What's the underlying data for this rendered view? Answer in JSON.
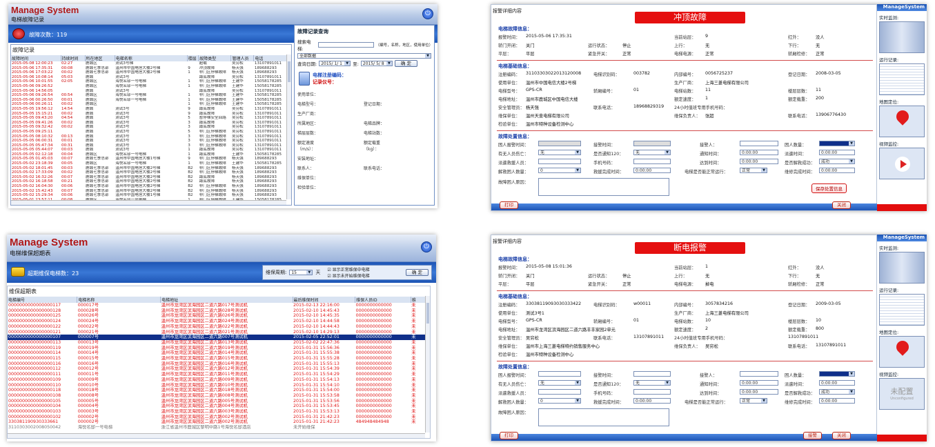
{
  "p1": {
    "brand": "Manage System",
    "subtitle": "电梯故障记录",
    "fault_count": "故障次数：119",
    "table_caption": "故障记录",
    "columns": [
      "故障时间",
      "持续时间",
      "所在地区",
      "电梯名称",
      "楼层",
      "故障类型",
      "管理人员",
      "电话"
    ],
    "rows": [
      [
        "2015-05-08 12:00:23",
        "02:27",
        "鹿城区",
        "测试3号梯",
        "",
        "超载",
        "吴穷松",
        "13107891011"
      ],
      [
        "2015-05-06 17:35:31",
        "00:08",
        "鹿城七季总部",
        "温州市中国电信大楼2号梯",
        "9",
        "冲顶故障",
        "杨天强",
        "189688293"
      ],
      [
        "2015-05-06 17:03:22",
        "00:02",
        "鹿城七季总部",
        "温州市中国电信大楼2号梯",
        "1",
        "非门区停梯故障",
        "杨天强",
        "189688293"
      ],
      [
        "2015-05-06 10:08:14",
        "05:03",
        "鹿城",
        "测试3号",
        "",
        "蹲底故障",
        "吴穷松",
        "13107891011"
      ],
      [
        "2015-05-06 10:01:55",
        "02:05",
        "鹿城区",
        "海悦名邸一号电梯",
        "1",
        "非门区停梯故障",
        "王建华",
        "15058178285"
      ],
      [
        "2015-05-06 09:26:52",
        "",
        "鹿城区",
        "海悦名邸一号电梯",
        "1",
        "非门区停梯故障",
        "王建华",
        "15058178285"
      ],
      [
        "2015-05-06 14:56:05",
        "",
        "鹿城",
        "测试3号",
        "",
        "蹲底故障",
        "吴穷松",
        "13107891011"
      ],
      [
        "2015-05-06 09:26:54",
        "00:54",
        "鹿城区",
        "海悦名邸一号电梯",
        "1",
        "非门区停梯故障",
        "王建华",
        "15058178285"
      ],
      [
        "2015-05-06 00:26:50",
        "00:01",
        "鹿城区",
        "海悦名邸一号电梯",
        "1",
        "非门区停梯故障",
        "王建华",
        "15058178285"
      ],
      [
        "2015-05-06 00:26:11",
        "00:02",
        "鹿城区",
        "",
        "1",
        "非门区停梯故障",
        "王建华",
        "15058178285"
      ],
      [
        "2015-05-05 19:56:12",
        "14:54",
        "鹿城",
        "测试3号",
        "9",
        "蹲底故障",
        "吴穷松",
        "13107891011"
      ],
      [
        "2015-05-05 15:15:21",
        "00:02",
        "鹿城",
        "测试3号",
        "9",
        "蹲底故障",
        "吴穷松",
        "13107891011"
      ],
      [
        "2015-05-05 09:43:20",
        "04:54",
        "鹿城",
        "测试3号",
        "5",
        "暂停梯安全回路",
        "吴穷松",
        "13107891011"
      ],
      [
        "2015-05-05 09:41:26",
        "00:02",
        "鹿城",
        "测试3号",
        "3",
        "蹲底故障",
        "吴穷松",
        "13107891011"
      ],
      [
        "2015-05-05 09:32:42",
        "00:02",
        "鹿城",
        "测试3号",
        "3",
        "蹲底故障",
        "吴穷松",
        "13107891011"
      ],
      [
        "2015-05-05 09:25:11",
        "",
        "鹿城",
        "测试3号",
        "5",
        "非门区停梯故障",
        "吴穷松",
        "13107891011"
      ],
      [
        "2015-05-05 08:10:32",
        "00:13",
        "鹿城",
        "测试3号",
        "3",
        "非门区停梯故障",
        "吴穷松",
        "13107891011"
      ],
      [
        "2015-05-05 06:00:31",
        "00:01",
        "鹿城",
        "测试3号",
        "3",
        "非门区停梯故障",
        "吴穷松",
        "13107891011"
      ],
      [
        "2015-05-05 05:47:34",
        "00:31",
        "鹿城",
        "测试3号",
        "3",
        "非门区停梯故障",
        "吴穷松",
        "13107891011"
      ],
      [
        "2015-05-05 05:44:07",
        "00:03",
        "鹿城",
        "测试3号",
        "1",
        "蹲底故障",
        "吴穷松",
        "13107891011"
      ],
      [
        "2015-05-05 02:12:18",
        "00:04",
        "鹿城区",
        "海悦名邸一号电梯",
        "1",
        "蹲底故障",
        "王建华",
        "15058178285"
      ],
      [
        "2015-05-05 01:45:03",
        "00:07",
        "鹿城七季总部",
        "温州市中国电信大楼1号梯",
        "9",
        "非门区停梯故障",
        "杨天强",
        "189688293"
      ],
      [
        "2015-05-02 23:18:39",
        "00:05",
        "鹿城区",
        "海悦名邸一号电梯",
        "1",
        "非门区停梯故障",
        "王建华",
        "15058178285"
      ],
      [
        "2015-05-02 18:01:45",
        "00:03",
        "鹿城七季总部",
        "温州市中国电信大楼2号梯",
        "B2",
        "非门区停梯故障",
        "杨天强",
        "189688293"
      ],
      [
        "2015-05-02 17:33:09",
        "00:02",
        "鹿城七季总部",
        "温州市中国电信大楼2号梯",
        "B2",
        "非门区停梯故障",
        "杨天强",
        "189688293"
      ],
      [
        "2015-05-02 16:32:26",
        "00:07",
        "鹿城七季总部",
        "温州市中国电信大楼2号梯",
        "B2",
        "蹲底故障",
        "杨天强",
        "189688293"
      ],
      [
        "2015-05-02 16:18:58",
        "00:21",
        "鹿城七季总部",
        "温州市中国电信大楼2号梯",
        "B2",
        "蹲底故障",
        "杨天强",
        "189688293"
      ],
      [
        "2015-05-02 16:04:30",
        "00:06",
        "鹿城七季总部",
        "温州市中国电信大楼2号梯",
        "B2",
        "非门区停梯故障",
        "杨天强",
        "189688293"
      ],
      [
        "2015-05-02 15:42:43",
        "00:07",
        "鹿城七季总部",
        "温州市中国电信大楼2号梯",
        "B2",
        "非门区停梯故障",
        "杨天强",
        "189688293"
      ],
      [
        "2015-05-02 15:29:34",
        "00:06",
        "鹿城七季总部",
        "温州市中国电信大楼1号梯",
        "B2",
        "非门区停梯故障",
        "杨天强",
        "189688293"
      ],
      [
        "2015-05-01 23:57:11",
        "00:08",
        "鹿城区",
        "海悦名邸一号电梯",
        "1",
        "非门区停梯故障",
        "王建华",
        "15058178285"
      ],
      [
        "2015-05-01 15:48:22",
        "00:01",
        "鹿城七季总部",
        "温州市中国电信大楼1号梯",
        "B2",
        "非门区停梯故障",
        "杨天强",
        "189688293"
      ],
      [
        "2015-05-01 10:16:31",
        "00:08",
        "鹿城区",
        "海悦名邸一号电梯",
        "1",
        "非门区停梯故障",
        "王建华",
        "15058178285"
      ],
      [
        "2015-04-30 11:22:13",
        "00:05",
        "鹿城区",
        "海悦名邸一号电梯",
        "1",
        "暂停梯安全回路",
        "王建华",
        "15058178285"
      ],
      [
        "2015-04-30 10:13:36",
        "00:01",
        "鹿城区",
        "海悦名邸一号电梯",
        "1",
        "非门区停梯故障",
        "王建华",
        "15058178285"
      ],
      [
        "2015-04-29 14:55:13",
        "",
        "鹿城",
        "测试3号",
        "1",
        "蹲底故障",
        "吴穷松",
        "13107891011"
      ]
    ],
    "query": {
      "title": "故障记录查询",
      "search_label": "搜索电梯:",
      "search_value": "",
      "search_hint": "（编号，名称，地区，使用单位）",
      "area_select": "全部数据",
      "date_label": "查询日期:",
      "date_from": "2015/ 1/ 1",
      "to_label": "至:",
      "date_to": "2015/ 5/ 8",
      "confirm": "确 定"
    },
    "info": {
      "l1": "电梯注册编码：",
      "l2": "记录仪号：",
      "fields": [
        "使用单位：",
        "",
        "",
        "",
        "电梯型号：",
        "",
        "登记日期：",
        "",
        "生产厂商：",
        "",
        "",
        "",
        "所属地区：",
        "",
        "电梯品牌：",
        "",
        "梯层层数：",
        "",
        "电梯站数：",
        "",
        "额定速度（m/s）：",
        "",
        "额定载重（kg）：",
        "",
        "安装地址：",
        "",
        "",
        "",
        "联系人：",
        "",
        "联系电话：",
        "",
        "维保单位：",
        "",
        "",
        "",
        "检验单位：",
        "",
        "",
        ""
      ]
    }
  },
  "p2": {
    "title": "报警详细内容",
    "banner": "冲顶故障",
    "sec1": "电梯故障信息：",
    "alarm_time_label": "报警时间：",
    "alarm_time": "2015-05-06 17:35:31",
    "cur_floor_label": "当前站层：",
    "cur_floor": "9",
    "ir_label": "红外：",
    "ir": "没人",
    "door_label": "轿门开闭：",
    "door": "关门",
    "run_label": "运行状态：",
    "run": "停止",
    "up_label": "上行：",
    "up": "无",
    "down_label": "下行：",
    "down": "无",
    "level_label": "平层：",
    "level": "平层",
    "brake_label": "紧急开关：",
    "brake": "正常",
    "power_label": "电梯电源：",
    "power": "正常",
    "overload_label": "轿厢检修：",
    "overload": "正常",
    "sec2": "电梯基础信息：",
    "reg_label": "注册编码：",
    "reg": "31103303022013120008",
    "idcode_label": "电梯识别码：",
    "idcode": "003782",
    "inner_label": "内部编号：",
    "inner": "0056725237",
    "regdate_label": "登记日期：",
    "regdate": "2008-03-05",
    "unit_label": "使用单位：",
    "unit": "温州市中国电信大楼2号梯",
    "maker_label": "生产厂商：",
    "maker": "上海三菱电梯有限公司",
    "model_label": "电梯型号：",
    "model": "GPS-CR",
    "brand_label": "轿厢编号：",
    "brand": "01",
    "stops_label": "电梯站数：",
    "stops": "11",
    "floors_label": "楼层层数：",
    "floors": "11",
    "addr_label": "电梯地址：",
    "addr": "温州市鹿城区中国电信大楼",
    "speed_label": "额定速度：",
    "speed": "1",
    "load_label": "额定载重：",
    "load": "200",
    "safety_label": "安全管理员：",
    "safety": "杨天强",
    "contact_label": "联系电话：",
    "contact": "18968829319",
    "hotline_label": "24小时值班专用手机号码：",
    "hotline": "",
    "maint_label": "维保单位：",
    "maint": "温州天斐电梯有限公司",
    "mperson_label": "维保负责人：",
    "mperson": "张超",
    "mphone_label": "联系电话：",
    "mphone": "13906776430",
    "check_label": "检验单位：",
    "check": "温州市特种设备检测中心",
    "sec3": "故障处置信息：",
    "h_time_label": "困人报警时间：",
    "h_alarm_label": "接警时间：",
    "h_person_label": "接警人：",
    "h_count_label": "困人数量：",
    "h_injury_label": "有无人员伤亡：",
    "h_injury": "无",
    "h_120_label": "是否通知120：",
    "h_120": "无",
    "h_notify_label": "通知时间：",
    "h_notify": "0:00:00",
    "h_dispatch_label": "派遣时间：",
    "h_dispatch": "0:00:00",
    "h_rescuer_label": "派遣救援人员：",
    "h_phone_label": "手机号码：",
    "h_arrive_label": "达到时间：",
    "h_arrive": "0:00:00",
    "h_success_label": "是否解救成功：",
    "h_success": "成功",
    "h_release_label": "解救困人数量：",
    "h_release": "0",
    "h_end_label": "救援完成时间：",
    "h_end": "0:00:00",
    "h_normal_label": "电梯是否能正常运行：",
    "h_normal": "正常",
    "h_fix_label": "维修完成时间：",
    "h_fix": "0:00:00",
    "h_reason_label": "故障困人原因：",
    "save": "保存处置信息",
    "print": "打印",
    "close": "关闭",
    "side": {
      "brand": "ManageSystem",
      "live": "实时监测:",
      "log": "运行记录:",
      "map": "地图定位:",
      "video": "视频监控:"
    }
  },
  "p3": {
    "brand": "Manage System",
    "subtitle": "电梯维保超期表",
    "overdue": "超期维保电梯数：23",
    "period_label": "维保周期:",
    "period": "15",
    "days": "天",
    "cb1": "显示正常维保中电梯",
    "cb2": "显示未开始维保电梯",
    "confirm": "确 定",
    "caption": "维保超期表",
    "columns": [
      "电梯编号",
      "电梯名称",
      "电梯地址",
      "最后维保时间",
      "维保人员ID",
      "维"
    ],
    "rows": [
      [
        "0000000000000000117",
        "000017号",
        "温州市龙湾区滨海园区二道六路017号测试机",
        "2015-02-13 22:16:00",
        "0000000000000",
        "未"
      ],
      [
        "0000000000000000128",
        "000028号",
        "温州市龙湾区滨海园区二道六路028号测试机",
        "2015-02-10 14:45:43",
        "0000000000000",
        "未"
      ],
      [
        "0000000000000000125",
        "000026号",
        "温州市龙湾区滨海园区二道六路026号测试机",
        "2015-02-10 14:45:35",
        "0000000000000",
        "未"
      ],
      [
        "0000000000000000124",
        "000024号",
        "温州市龙湾区滨海园区二道六路024号测试机",
        "2015-02-10 14:44:58",
        "0000000000000",
        "未"
      ],
      [
        "0000000000000000122",
        "000022号",
        "温州市龙湾区滨海园区二道六路022号测试机",
        "2015-02-10 14:44:43",
        "0000000000000",
        "未"
      ],
      [
        "0000000000000000121",
        "000021号",
        "温州市龙湾区滨海园区二道六路021号测试机",
        "2015-02-10 14:29:13",
        "0000000000000",
        "未"
      ],
      [
        "0000000000000000107",
        "000007号",
        "温州市龙湾区滨海园区二道六路007号测试机",
        "2015-02-05 22:52:01",
        "0000000000000",
        "未"
      ],
      [
        "0000000000000000113",
        "000013号",
        "温州市龙湾区滨海园区二道六路013号测试机",
        "2015-02-02 22:47:36",
        "0000000000000",
        "未"
      ],
      [
        "0000000000000000119",
        "000019号",
        "温州市龙湾区滨海园区二道六路019号测试机",
        "2015-01-31 15:56:36",
        "0000000000000",
        "未"
      ],
      [
        "0000000000000000114",
        "000014号",
        "温州市龙湾区滨海园区二道六路014号测试机",
        "2015-01-31 15:55:38",
        "0000000000000",
        "未"
      ],
      [
        "0000000000000000115",
        "000015号",
        "温州市龙湾区滨海园区二道六路015号测试机",
        "2015-01-31 15:55:28",
        "0000000000000",
        "未"
      ],
      [
        "0000000000000000116",
        "000016号",
        "温州市龙湾区滨海园区二道六路016号测试机",
        "2015-01-31 15:55:13",
        "0000000000000",
        "未"
      ],
      [
        "0000000000000000112",
        "000012号",
        "温州市龙湾区滨海园区二道六路012号测试机",
        "2015-01-31 15:54:39",
        "0000000000000",
        "未"
      ],
      [
        "0000000000000000111",
        "000011号",
        "温州市龙湾区滨海园区二道六路011号测试机",
        "2015-01-31 15:54:29",
        "0000000000000",
        "未"
      ],
      [
        "0000000000000000109",
        "000009号",
        "温州市龙湾区滨海园区二道六路009号测试机",
        "2015-01-31 15:54:13",
        "0000000000000",
        "未"
      ],
      [
        "0000000000000000110",
        "000010号",
        "温州市龙湾区滨海园区二道六路010号测试机",
        "2015-01-31 15:54:10",
        "0000000000000",
        "未"
      ],
      [
        "0000000000000000118",
        "000018号",
        "温州市龙湾区滨海园区二道六路018号测试机",
        "2015-01-31 15:54:00",
        "0000000000000",
        "未"
      ],
      [
        "0000000000000000108",
        "000008号",
        "温州市龙湾区滨海园区二道六路008号测试机",
        "2015-01-31 15:53:58",
        "0000000000000",
        "未"
      ],
      [
        "0000000000000000105",
        "000005号",
        "温州市龙湾区滨海园区二道六路005号测试机",
        "2015-01-31 15:53:56",
        "0000000000000",
        "未"
      ],
      [
        "0000000000000000104",
        "000004号",
        "温州市龙湾区滨海园区二道六路004号测试机",
        "2015-01-31 15:53:45",
        "0000000000000",
        "未"
      ],
      [
        "0000000000000000103",
        "000003号",
        "温州市龙湾区滨海园区二道六路003号测试机",
        "2015-01-31 15:53:13",
        "0000000000000",
        "未"
      ],
      [
        "0000000000000000102",
        "000002号",
        "温州市龙湾区滨海园区二道六路002号测试机",
        "2015-01-31 21:42:23",
        "0000000000000",
        "未"
      ],
      [
        "330381190930333661",
        "000002号",
        "温州市龙湾区滨海园区二道六路002号测试机",
        "2015-01-31 21:42:23",
        "484948484948",
        "未"
      ],
      [
        "3110303002008050042",
        "海悦名邸一号电梯",
        "浙江省温州市鹿城区黎明中路1号海悦名邸酒店",
        "未开始维保",
        "",
        ""
      ]
    ]
  },
  "p4": {
    "title": "报警详细内容",
    "banner": "断电报警",
    "sec1": "电梯故障信息：",
    "alarm_time": "2015-05-08 15:01:36",
    "cur_floor": "1",
    "ir": "没人",
    "door": "关门",
    "run": "停止",
    "up": "无",
    "down": "无",
    "level": "平层",
    "brake": "正常",
    "power": "掉电",
    "overload": "正常",
    "sec2": "电梯基础信息：",
    "reg": "33038119093030333422",
    "idcode": "w00011",
    "inner": "3057834216",
    "regdate": "2009-03-05",
    "unit": "测试3号1",
    "maker": "上海三菱电梯有限公司",
    "model": "GPS-CR",
    "brand": "01",
    "stops": "10",
    "floors": "10",
    "addr": "温州市龙湾区滨海园区二道六路丰丰家园2单元",
    "speed": "2",
    "load": "800",
    "safety": "吴穷松",
    "contact": "13107891011",
    "hotline": "13107891011",
    "maint": "温州市上海三菱电梯特约销售服务中心",
    "mperson": "吴穷松",
    "mphone": "13107891011",
    "check": "温州市特种设备检测中心",
    "sec3": "故障处置信息：",
    "h_injury": "无",
    "h_120": "无",
    "h_notify": "0:00:00",
    "h_dispatch": "0:00:00",
    "h_arrive": "0:00:00",
    "h_success": "成功",
    "h_release": "0",
    "h_end": "0:00:00",
    "h_normal": "正常",
    "h_fix": "0:00:00",
    "print": "打印",
    "alarm_btn": "接警",
    "close": "关闭",
    "side": {
      "brand": "ManageSystem",
      "live": "实时监测:",
      "log": "运行记录:",
      "map": "地图定位:",
      "video": "视频监控:",
      "unconfigured": "未配置",
      "unconfigured_en": "Unconfigured"
    }
  }
}
